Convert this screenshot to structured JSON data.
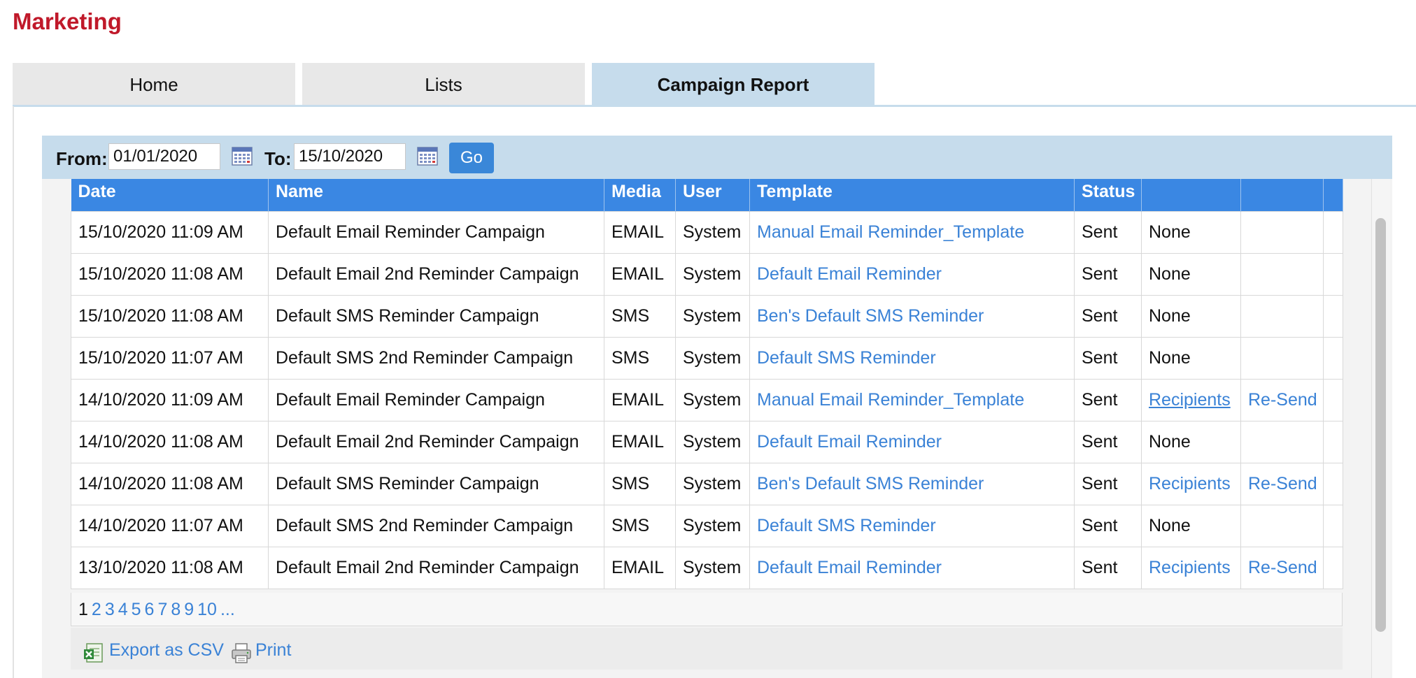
{
  "app": {
    "title": "Marketing"
  },
  "tabs": [
    {
      "label": "Home",
      "active": false
    },
    {
      "label": "Lists",
      "active": false
    },
    {
      "label": "Campaign Report",
      "active": true
    }
  ],
  "filter": {
    "from_label": "From:",
    "from_value": "01/01/2020",
    "to_label": "To:",
    "to_value": "15/10/2020",
    "go_label": "Go",
    "calendar_icon": "calendar-icon"
  },
  "table": {
    "columns": [
      "Date",
      "Name",
      "Media",
      "User",
      "Template",
      "Status",
      "",
      ""
    ],
    "rows": [
      {
        "date": "15/10/2020 11:09 AM",
        "name": "Default Email Reminder Campaign",
        "media": "EMAIL",
        "user": "System",
        "template": "Manual Email Reminder_Template",
        "status": "Sent",
        "recipients": "None",
        "resend": ""
      },
      {
        "date": "15/10/2020 11:08 AM",
        "name": "Default Email 2nd Reminder Campaign",
        "media": "EMAIL",
        "user": "System",
        "template": "Default Email Reminder",
        "status": "Sent",
        "recipients": "None",
        "resend": ""
      },
      {
        "date": "15/10/2020 11:08 AM",
        "name": "Default SMS Reminder Campaign",
        "media": "SMS",
        "user": "System",
        "template": "Ben's Default SMS Reminder",
        "status": "Sent",
        "recipients": "None",
        "resend": ""
      },
      {
        "date": "15/10/2020 11:07 AM",
        "name": "Default SMS 2nd Reminder Campaign",
        "media": "SMS",
        "user": "System",
        "template": "Default SMS Reminder",
        "status": "Sent",
        "recipients": "None",
        "resend": ""
      },
      {
        "date": "14/10/2020 11:09 AM",
        "name": "Default Email Reminder Campaign",
        "media": "EMAIL",
        "user": "System",
        "template": "Manual Email Reminder_Template",
        "status": "Sent",
        "recipients": "Recipients",
        "resend": "Re-Send"
      },
      {
        "date": "14/10/2020 11:08 AM",
        "name": "Default Email 2nd Reminder Campaign",
        "media": "EMAIL",
        "user": "System",
        "template": "Default Email Reminder",
        "status": "Sent",
        "recipients": "None",
        "resend": ""
      },
      {
        "date": "14/10/2020 11:08 AM",
        "name": "Default SMS Reminder Campaign",
        "media": "SMS",
        "user": "System",
        "template": "Ben's Default SMS Reminder",
        "status": "Sent",
        "recipients": "Recipients",
        "resend": "Re-Send"
      },
      {
        "date": "14/10/2020 11:07 AM",
        "name": "Default SMS 2nd Reminder Campaign",
        "media": "SMS",
        "user": "System",
        "template": "Default SMS Reminder",
        "status": "Sent",
        "recipients": "None",
        "resend": ""
      },
      {
        "date": "13/10/2020 11:08 AM",
        "name": "Default Email 2nd Reminder Campaign",
        "media": "EMAIL",
        "user": "System",
        "template": "Default Email Reminder",
        "status": "Sent",
        "recipients": "Recipients",
        "resend": "Re-Send"
      }
    ]
  },
  "pagination": {
    "current": "1",
    "pages": [
      "2",
      "3",
      "4",
      "5",
      "6",
      "7",
      "8",
      "9",
      "10",
      "..."
    ]
  },
  "actions": {
    "export_label": "Export as CSV",
    "export_icon": "excel-icon",
    "print_label": "Print",
    "print_icon": "printer-icon"
  },
  "colors": {
    "title": "#c0192a",
    "header_bg": "#3a87e3",
    "tab_active_bg": "#c6dcec",
    "link": "#3a82d6",
    "button_bg": "#3a87d8"
  }
}
